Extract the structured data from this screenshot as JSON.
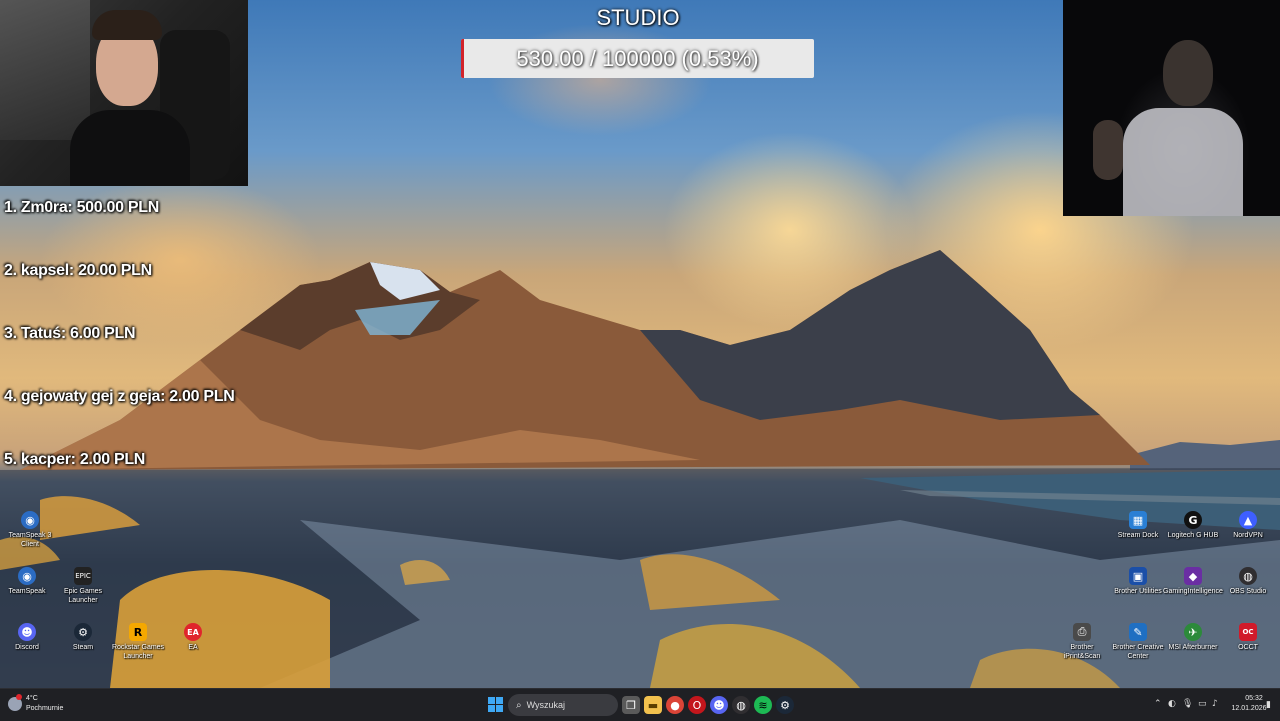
{
  "goal": {
    "title": "STUDIO",
    "progress_text": "530.00 / 100000 (0.53%)",
    "progress_fraction": 0.0053,
    "fill_color": "#d2232a"
  },
  "donors": [
    "1. Zm0ra: 500.00 PLN",
    "2. kapsel: 20.00 PLN",
    "3. Tatuś: 6.00 PLN",
    "4. gejowaty gej z geja: 2.00 PLN",
    "5. kacper: 2.00 PLN"
  ],
  "desktop_icons_left": [
    {
      "label": "TeamSpeak 3 Client",
      "icon": "teamspeak-icon",
      "color": "#2b6cc4"
    },
    {
      "label": "TeamSpeak",
      "icon": "teamspeak-icon",
      "color": "#2b6cc4"
    },
    {
      "label": "Epic Games Launcher",
      "icon": "epic-games-icon",
      "color": "#222222"
    },
    {
      "label": "Discord",
      "icon": "discord-icon",
      "color": "#5865f2"
    },
    {
      "label": "Steam",
      "icon": "steam-icon",
      "color": "#1b2838"
    },
    {
      "label": "Rockstar Games Launcher",
      "icon": "rockstar-icon",
      "color": "#f5a800"
    },
    {
      "label": "EA",
      "icon": "ea-icon",
      "color": "#e0252c"
    }
  ],
  "desktop_icons_right": [
    {
      "label": "Stream Dock",
      "icon": "stream-dock-icon",
      "color": "#2a7fd4"
    },
    {
      "label": "Logitech G HUB",
      "icon": "logitech-icon",
      "color": "#111111"
    },
    {
      "label": "NordVPN",
      "icon": "nordvpn-icon",
      "color": "#3e5fff"
    },
    {
      "label": "Brother Utilities",
      "icon": "brother-utilities-icon",
      "color": "#1b4fa8"
    },
    {
      "label": "GamingIntelligence",
      "icon": "gaming-intelligence-icon",
      "color": "#6a2ea3"
    },
    {
      "label": "OBS Studio",
      "icon": "obs-icon",
      "color": "#302e31"
    },
    {
      "label": "Brother iPrint&Scan",
      "icon": "brother-iprint-icon",
      "color": "#4a4a4a"
    },
    {
      "label": "Brother Creative Center",
      "icon": "brother-creative-icon",
      "color": "#1f6fc2"
    },
    {
      "label": "MSI Afterburner",
      "icon": "msi-afterburner-icon",
      "color": "#2c8a3a"
    },
    {
      "label": "OCCT",
      "icon": "occt-icon",
      "color": "#d11a2a"
    }
  ],
  "taskbar": {
    "weather_temp": "4°C",
    "weather_desc": "Pochmurnie",
    "search_placeholder": "Wyszukaj",
    "time": "05:32",
    "date": "12.01.2026",
    "pinned": [
      {
        "icon": "task-view-icon",
        "color": "#5a5a5a"
      },
      {
        "icon": "file-explorer-icon",
        "color": "#f2c14e"
      },
      {
        "icon": "chrome-icon",
        "color": "#db4437"
      },
      {
        "icon": "opera-icon",
        "color": "#c4161c"
      },
      {
        "icon": "discord-icon",
        "color": "#5865f2"
      },
      {
        "icon": "obs-icon",
        "color": "#302e31"
      },
      {
        "icon": "spotify-icon",
        "color": "#1db954"
      },
      {
        "icon": "steam-icon",
        "color": "#1b2838"
      }
    ]
  }
}
